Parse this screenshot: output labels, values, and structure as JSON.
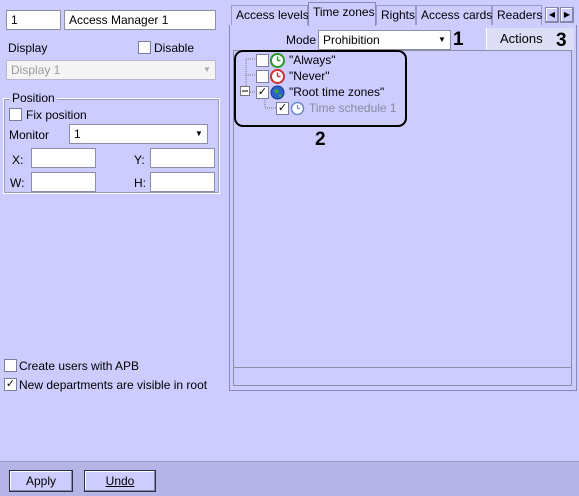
{
  "left": {
    "id_value": "1",
    "name_value": "Access Manager 1",
    "display_label": "Display",
    "disable_label": "Disable",
    "display_select": "Display 1",
    "position_title": "Position",
    "fix_position_label": "Fix position",
    "monitor_label": "Monitor",
    "monitor_value": "1",
    "x_label": "X:",
    "y_label": "Y:",
    "w_label": "W:",
    "h_label": "H:",
    "create_users_apb_label": "Create users with APB",
    "new_departments_label": "New departments are visible in root"
  },
  "tabs": [
    "Access levels",
    "Time zones",
    "Rights",
    "Access cards",
    "Readers"
  ],
  "tab_arrows": [
    "◀",
    "▶"
  ],
  "timezones": {
    "mode_label": "Mode",
    "mode_value": "Prohibition",
    "actions_label": "Actions",
    "tree": [
      {
        "label": "\"Always\"",
        "checked": false,
        "icon": "green-clock-icon"
      },
      {
        "label": "\"Never\"",
        "checked": false,
        "icon": "red-clock-icon"
      },
      {
        "label": "\"Root time zones\"",
        "checked": true,
        "icon": "globe-icon"
      },
      {
        "label": "Time schedule 1",
        "checked": true,
        "icon": "clock-icon"
      }
    ]
  },
  "callouts": [
    "1",
    "2",
    "3"
  ],
  "buttons": {
    "apply": "Apply",
    "undo": "Undo"
  },
  "colors": {
    "background": "#ccccff",
    "footer": "#b4b4e6",
    "callout_border": "#000000"
  }
}
